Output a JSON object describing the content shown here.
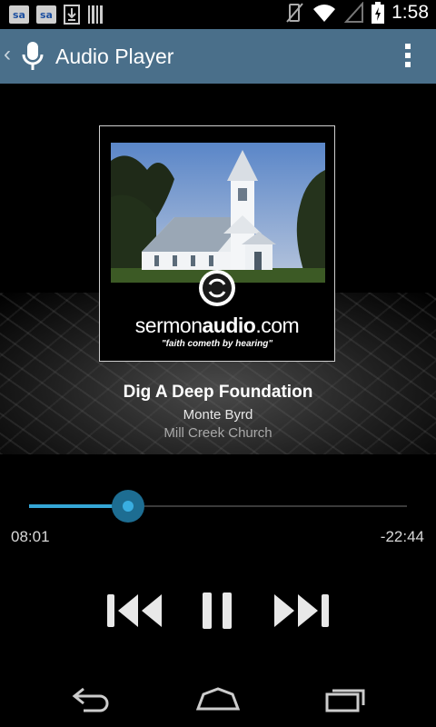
{
  "status_bar": {
    "notification_icons": [
      "sa",
      "sa",
      "download-icon",
      "barcode-icon"
    ],
    "system_icons": [
      "vibrate-off-icon",
      "wifi-icon",
      "signal-icon",
      "battery-charging-icon"
    ],
    "time": "1:58"
  },
  "action_bar": {
    "title": "Audio Player",
    "app_icon": "microphone-icon",
    "overflow_icon": "more-vert-icon"
  },
  "artwork": {
    "brand_prefix": "sermon",
    "brand_main": "audio",
    "brand_suffix": ".com",
    "tagline": "\"faith cometh by hearing\""
  },
  "track": {
    "title": "Dig A Deep Foundation",
    "speaker": "Monte Byrd",
    "church": "Mill Creek Church"
  },
  "player": {
    "elapsed": "08:01",
    "remaining": "-22:44",
    "progress": 0.262,
    "accent_color": "#35a6d6",
    "buttons": [
      "previous-icon",
      "pause-icon",
      "next-icon"
    ]
  },
  "nav_bar": {
    "buttons": [
      "back-icon",
      "home-icon",
      "recents-icon"
    ]
  }
}
